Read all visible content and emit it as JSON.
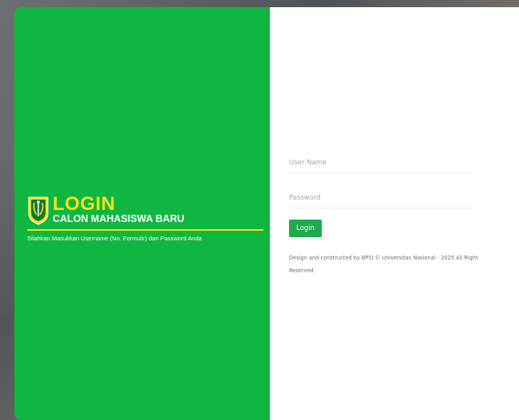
{
  "brand": {
    "title": "LOGIN",
    "subtitle": "CALON MAHASISWA BARU",
    "instruction": "Silahkan Masukkan Username (No. Formulir) dan Password Anda",
    "logo_icon": "university-shield-logo-icon"
  },
  "form": {
    "username_placeholder": "User Name",
    "password_placeholder": "Password",
    "login_label": "Login"
  },
  "footer": {
    "text": "Design and constructed by BPSI © Universitas Nasional - 2025 All Right Reserved"
  },
  "colors": {
    "panel_green": "#0fb742",
    "accent_yellow": "#f4e21a",
    "button_green": "#1faa4c"
  }
}
